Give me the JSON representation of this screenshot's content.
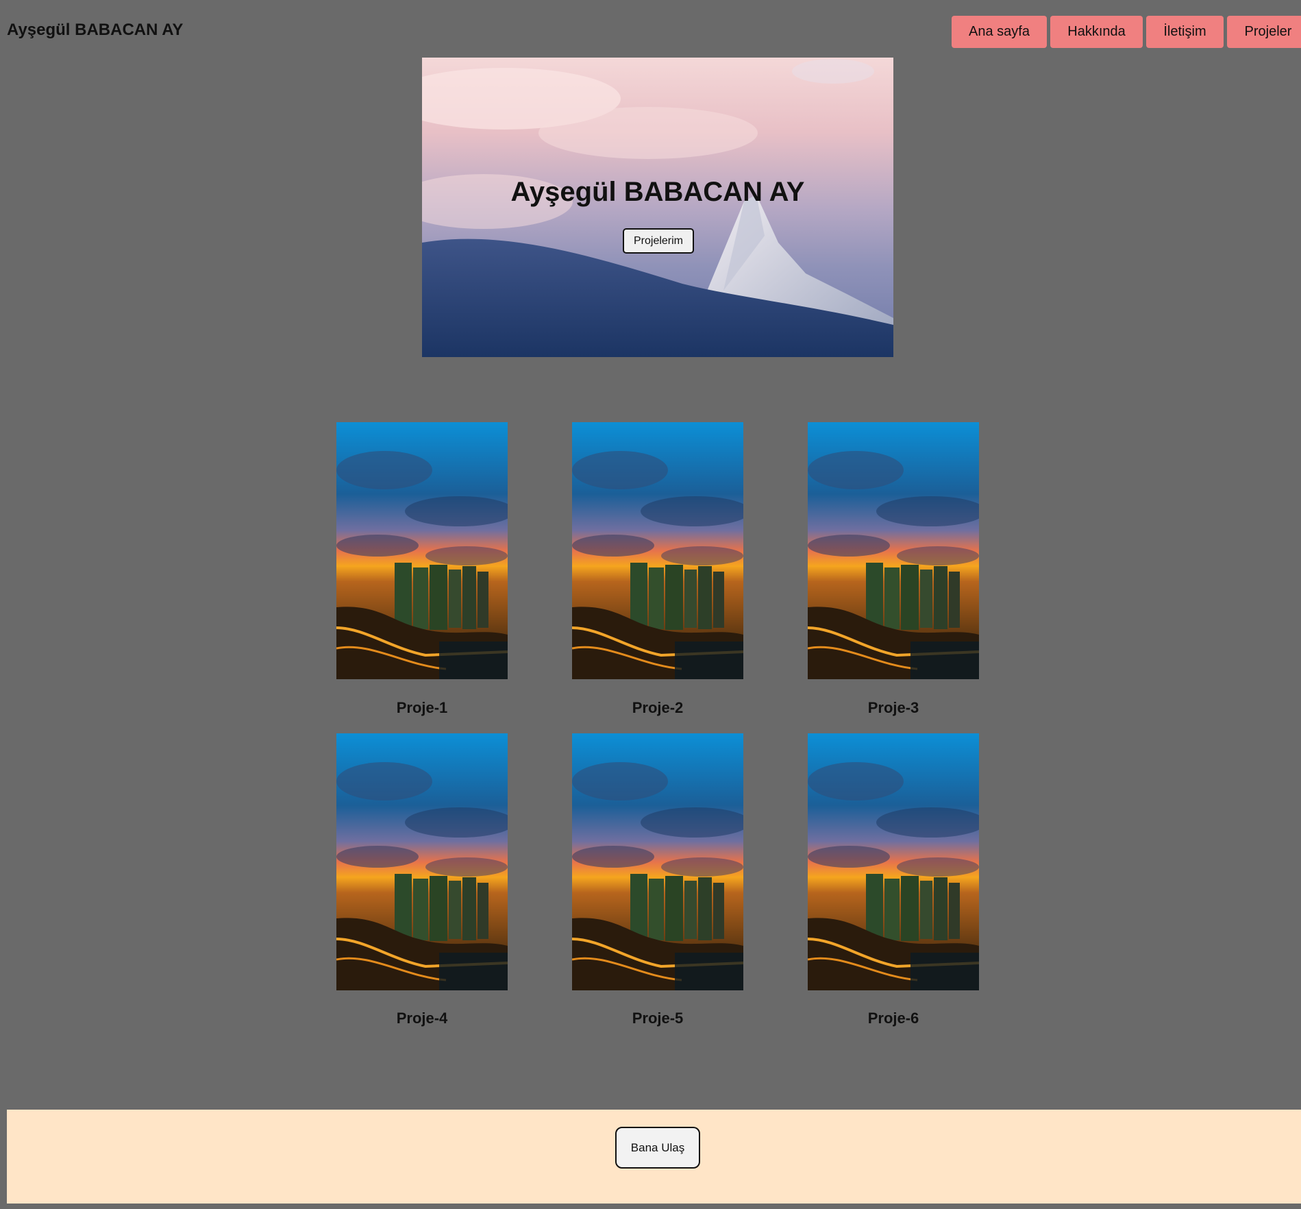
{
  "header": {
    "site_title": "Ayşegül BABACAN AY",
    "nav": [
      "Ana sayfa",
      "Hakkında",
      "İletişim",
      "Projeler"
    ]
  },
  "hero": {
    "title": "Ayşegül BABACAN AY",
    "button_label": "Projelerim"
  },
  "projects": [
    "Proje-1",
    "Proje-2",
    "Proje-3",
    "Proje-4",
    "Proje-5",
    "Proje-6"
  ],
  "footer": {
    "button_label": "Bana Ulaş"
  },
  "colors": {
    "page_background": "#6a6a6a",
    "nav_button": "#f08080",
    "footer_background": "#ffe5c7"
  }
}
